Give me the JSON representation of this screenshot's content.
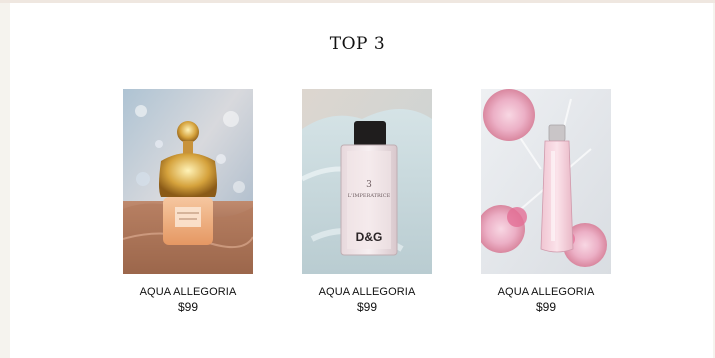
{
  "section": {
    "title": "TOP 3"
  },
  "products": [
    {
      "name": "AQUA ALLEGORIA",
      "price": "$99",
      "image_icon": "perfume-bottle-gold-icon"
    },
    {
      "name": "AQUA ALLEGORIA",
      "price": "$99",
      "image_icon": "perfume-bottle-dg-icon",
      "bottle_labels": [
        "3",
        "L'IMPERATRICE",
        "D&G"
      ]
    },
    {
      "name": "AQUA ALLEGORIA",
      "price": "$99",
      "image_icon": "perfume-bottle-pink-icon"
    }
  ],
  "colors": {
    "background": "#f5f3ee",
    "panel": "#ffffff",
    "text": "#111111"
  }
}
